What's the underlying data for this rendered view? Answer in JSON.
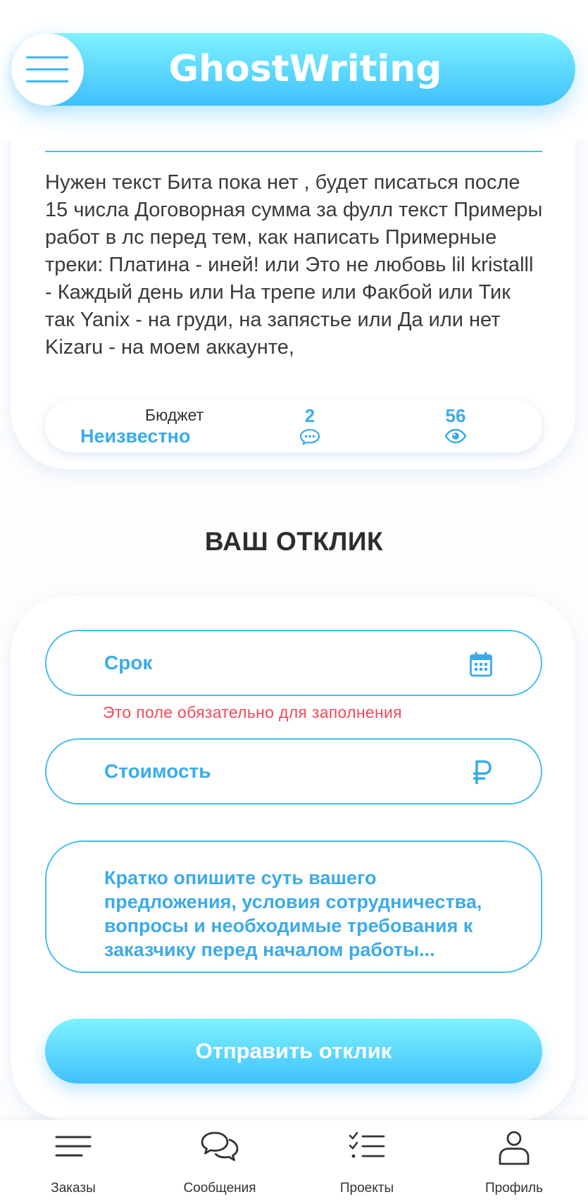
{
  "header": {
    "brand": "GhostWriting",
    "menu_icon": "hamburger-menu-icon"
  },
  "order": {
    "description": "Нужен текст Бита пока нет , будет писаться после 15 числа Договорная сумма за фулл текст Примеры работ в лс перед тем, как написать Примерные треки: Платина - иней! или Это не любовь lil kristalll - Каждый день или На трепе или Факбой или Тик так Yanix - на груди, на запястье или Да или нет Kizaru - на моем аккаунте,",
    "budget_label": "Бюджет",
    "budget_value": "Неизвестно",
    "comments_count": "2",
    "comments_icon": "comment-bubble-icon",
    "views_count": "56",
    "views_icon": "eye-icon"
  },
  "response": {
    "title": "ВАШ ОТКЛИК",
    "deadline_placeholder": "Срок",
    "deadline_icon": "calendar-icon",
    "deadline_error": "Это поле обязательно для заполнения",
    "cost_placeholder": "Стоимость",
    "cost_icon": "ruble-icon",
    "message_placeholder": "Кратко опишите суть вашего предложения, условия сотрудничества, вопросы и необходимые требования к заказчику перед началом работы...",
    "submit_label": "Отправить отклик"
  },
  "nav": {
    "items": [
      {
        "label": "Заказы",
        "icon": "list-icon"
      },
      {
        "label": "Сообщения",
        "icon": "chat-bubbles-icon"
      },
      {
        "label": "Проекты",
        "icon": "checklist-icon"
      },
      {
        "label": "Профиль",
        "icon": "user-icon"
      }
    ]
  },
  "colors": {
    "accent": "#3aabea",
    "gradient_start": "#7ff2ff",
    "gradient_end": "#3fc1fb",
    "error": "#ee4a58"
  }
}
